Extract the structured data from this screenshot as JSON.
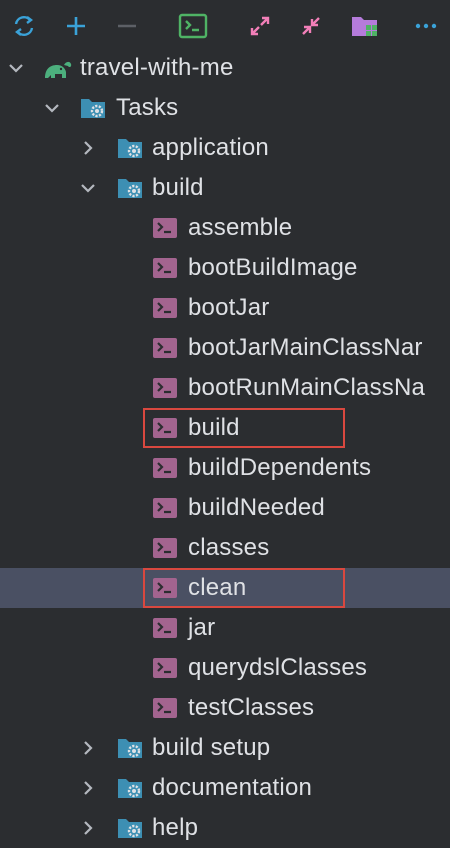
{
  "toolbar": {
    "buttons": [
      {
        "name": "refresh-icon",
        "label": "Reload All Gradle Projects"
      },
      {
        "name": "plus-icon",
        "label": "Link Gradle Project"
      },
      {
        "name": "minus-icon",
        "label": "Unlink Gradle Project"
      },
      {
        "name": "terminal-icon",
        "label": "Execute Gradle Task"
      },
      {
        "name": "expand-all-icon",
        "label": "Expand All"
      },
      {
        "name": "collapse-all-icon",
        "label": "Collapse All"
      },
      {
        "name": "folder-grid-icon",
        "label": "Group Modules"
      },
      {
        "name": "more-icon",
        "label": "More"
      }
    ]
  },
  "tree": {
    "project": {
      "label": "travel-with-me",
      "icon": "gradle-elephant-icon",
      "expanded": true
    },
    "tasks_folder": {
      "label": "Tasks",
      "icon": "gear-folder-icon",
      "expanded": true
    },
    "groups": [
      {
        "label": "application",
        "expanded": false
      },
      {
        "label": "build",
        "expanded": true
      },
      {
        "label": "build setup",
        "expanded": false
      },
      {
        "label": "documentation",
        "expanded": false
      },
      {
        "label": "help",
        "expanded": false
      }
    ],
    "build_tasks": [
      "assemble",
      "bootBuildImage",
      "bootJar",
      "bootJarMainClassNar",
      "bootRunMainClassNa",
      "build",
      "buildDependents",
      "buildNeeded",
      "classes",
      "clean",
      "jar",
      "querydslClasses",
      "testClasses"
    ],
    "selected_task": "clean",
    "highlighted_tasks": [
      "build",
      "clean"
    ]
  },
  "colors": {
    "background": "#2b2d30",
    "selection": "#4a5063",
    "highlight_border": "#d9483f",
    "folder": "#3d8fb3",
    "gear": "#dfe1e5",
    "task_icon": "#a3648f",
    "gradle": "#4caf7d",
    "toolbar_blue": "#3aa2d8",
    "toolbar_green": "#4fb365",
    "toolbar_pink": "#f27fb8",
    "toolbar_purple": "#b57bdb"
  }
}
